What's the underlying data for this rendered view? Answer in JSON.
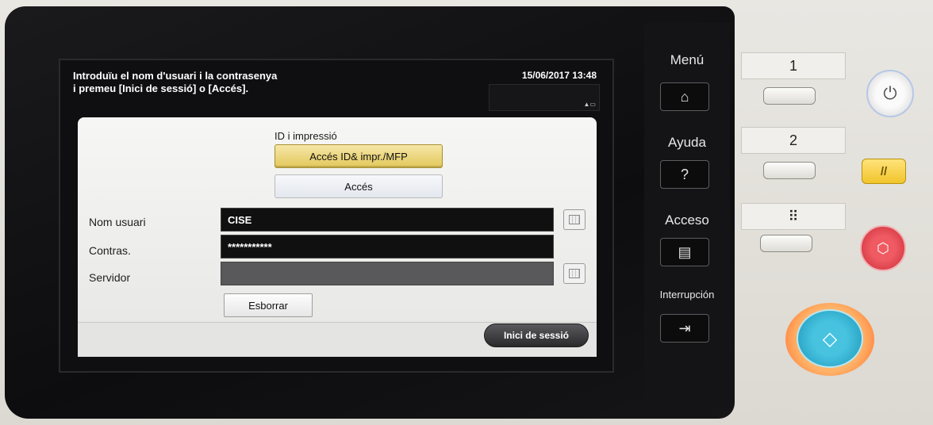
{
  "screen": {
    "prompt_line1": "Introduïu el nom d'usuari i la contrasenya",
    "prompt_line2": "i premeu [Inici de sessió] o [Accés].",
    "datetime": "15/06/2017 13:48",
    "status_icon": "signal-battery-icon"
  },
  "auth": {
    "title": "ID i impressió",
    "option_selected": "Accés ID& impr./MFP",
    "option_other": "Accés"
  },
  "form": {
    "username_label": "Nom usuari",
    "username_value": "CISE",
    "password_label": "Contras.",
    "password_value": "***********",
    "server_label": "Servidor",
    "server_value": "",
    "clear_label": "Esborrar",
    "login_label": "Inici de sessió"
  },
  "side_keys": {
    "menu_label": "Menú",
    "help_label": "Ayuda",
    "help_symbol": "?",
    "access_label": "Acceso",
    "interrupt_label": "Interrupción"
  },
  "panel": {
    "slot1_label": "1",
    "slot2_label": "2",
    "keypad_label": "⠿"
  },
  "colors": {
    "selected_button": "#e3c85a",
    "login_button": "#2a2a2d",
    "start_button": "#1f95b8",
    "stop_button": "#c92c39",
    "reset_button": "#f1c52b"
  }
}
